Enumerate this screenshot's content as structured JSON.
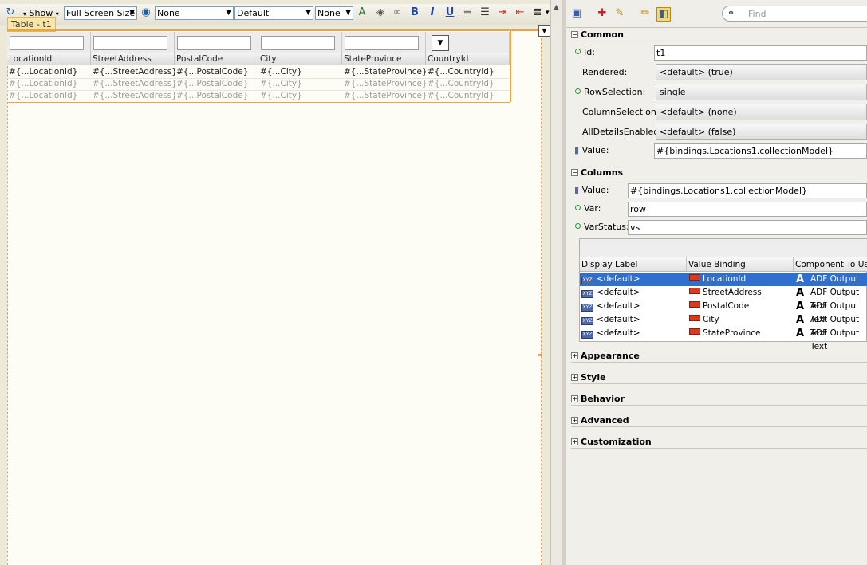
{
  "toolbar": {
    "show_label": "Show",
    "screen_size": "Full Screen Size",
    "combo1": "None",
    "combo2": "Default",
    "combo3": "None"
  },
  "designer": {
    "table_tag": "Table - t1",
    "columns": [
      "LocationId",
      "StreetAddress",
      "PostalCode",
      "City",
      "StateProvince",
      "CountryId"
    ],
    "rows": [
      [
        "#{...LocationId}",
        "#{...StreetAddress}",
        "#{...PostalCode}",
        "#{...City}",
        "#{...StateProvince}",
        "#{...CountryId}"
      ],
      [
        "#{...LocationId}",
        "#{...StreetAddress}",
        "#{...PostalCode}",
        "#{...City}",
        "#{...StateProvince}",
        "#{...CountryId}"
      ],
      [
        "#{...LocationId}",
        "#{...StreetAddress}",
        "#{...PostalCode}",
        "#{...City}",
        "#{...StateProvince}",
        "#{...CountryId}"
      ]
    ]
  },
  "inspector": {
    "find_placeholder": "Find",
    "common": {
      "title": "Common",
      "id_label": "Id:",
      "id_value": "t1",
      "rendered_label": "Rendered:",
      "rendered_value": "<default> (true)",
      "rowsel_label": "RowSelection:",
      "rowsel_value": "single",
      "colsel_label": "ColumnSelection:",
      "colsel_value": "<default> (none)",
      "alldetails_label": "AllDetailsEnabled:",
      "alldetails_value": "<default> (false)",
      "value_label": "Value:",
      "value_value": "#{bindings.Locations1.collectionModel}"
    },
    "columns": {
      "title": "Columns",
      "value_label": "Value:",
      "value_value": "#{bindings.Locations1.collectionModel}",
      "var_label": "Var:",
      "var_value": "row",
      "varstatus_label": "VarStatus:",
      "varstatus_value": "vs",
      "grid_headers": [
        "Display Label",
        "Value Binding",
        "Component To Use"
      ],
      "grid_rows": [
        {
          "label": "<default>",
          "binding": "LocationId",
          "component": "ADF Output Text"
        },
        {
          "label": "<default>",
          "binding": "StreetAddress",
          "component": "ADF Output Text"
        },
        {
          "label": "<default>",
          "binding": "PostalCode",
          "component": "ADF Output Text"
        },
        {
          "label": "<default>",
          "binding": "City",
          "component": "ADF Output Text"
        },
        {
          "label": "<default>",
          "binding": "StateProvince",
          "component": "ADF Output Text"
        }
      ]
    },
    "sections": [
      "Appearance",
      "Style",
      "Behavior",
      "Advanced",
      "Customization"
    ]
  },
  "colors": {
    "selection": "#2f6fcf",
    "design_border": "#f0a33c",
    "required_dot": "#2b9a2b"
  }
}
